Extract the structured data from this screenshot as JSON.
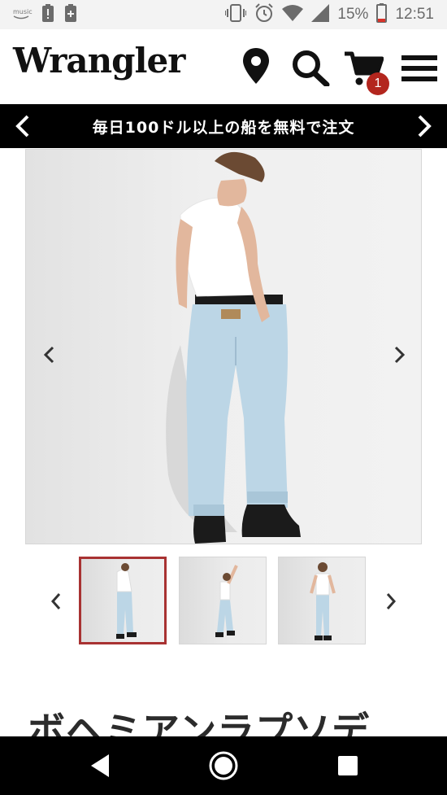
{
  "status_bar": {
    "music_label": "music",
    "battery_percent": "15%",
    "time": "12:51",
    "icons": [
      "amazon-music-icon",
      "alert-icon",
      "battery-saver-icon",
      "vibrate-icon",
      "alarm-icon",
      "wifi-icon",
      "signal-icon",
      "battery-icon"
    ]
  },
  "header": {
    "logo_text": "Wrangler",
    "cart_count": "1",
    "icons": [
      "location-pin-icon",
      "search-icon",
      "cart-icon",
      "menu-icon"
    ]
  },
  "promo": {
    "text": "毎日100ドル以上の船を無料で注文"
  },
  "gallery": {
    "thumbnail_count": 3,
    "active_index": 0
  },
  "product": {
    "title": "ボヘミアンラプソデ"
  },
  "colors": {
    "accent_red": "#b3261e",
    "thumb_border": "#a83232",
    "promo_bg": "#000000",
    "denim": "#bcd6e6"
  }
}
